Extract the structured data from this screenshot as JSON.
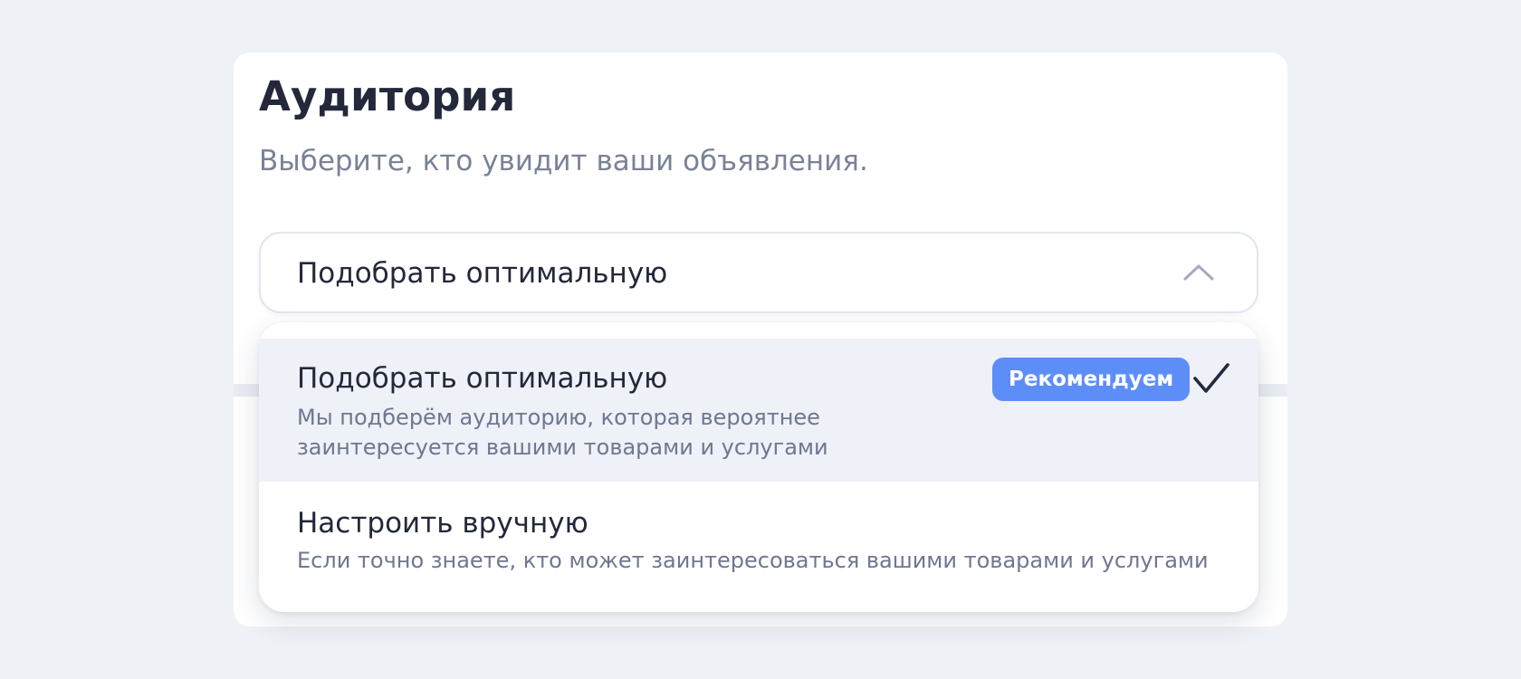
{
  "audience": {
    "title": "Аудитория",
    "subtitle": "Выберите, кто увидит ваши объявления.",
    "select": {
      "value": "Подобрать оптимальную",
      "icon": "chevron-up-icon",
      "expanded": true
    },
    "options": [
      {
        "title": "Подобрать оптимальную",
        "description": "Мы подберём аудиторию, которая вероятнее заинтересуется вашими товарами и услугами",
        "badge": "Рекомендуем",
        "selected": true,
        "icon": "checkmark-icon"
      },
      {
        "title": "Настроить вручную",
        "description": "Если точно знаете, кто может заинтересоваться вашими товарами и услугами",
        "selected": false
      }
    ]
  },
  "colors": {
    "background": "#eef1f6",
    "card": "#ffffff",
    "text_primary": "#23283a",
    "text_secondary": "#7a8298",
    "badge": "#5d8ef8",
    "selected_option_bg": "#eef1f7"
  }
}
